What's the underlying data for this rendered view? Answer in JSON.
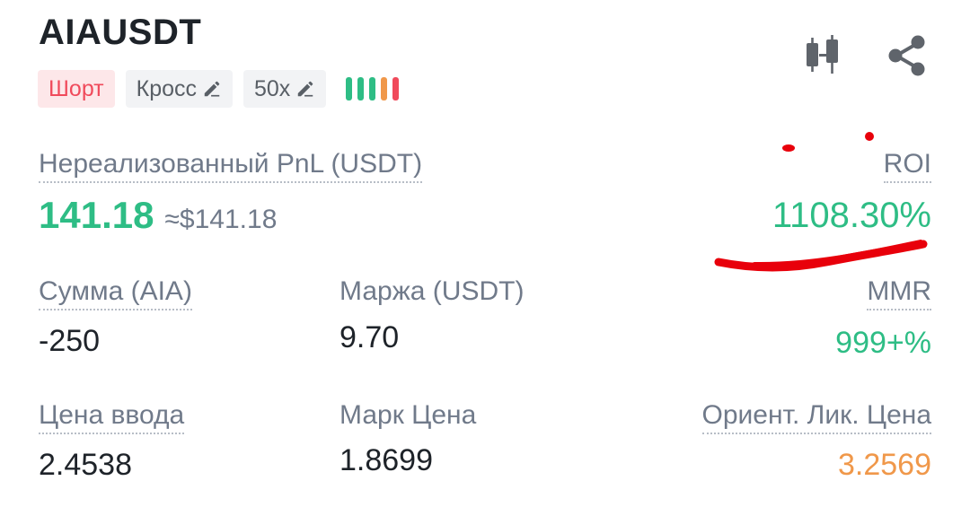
{
  "position": {
    "symbol": "AIAUSDT",
    "side_tag": "Шорт",
    "margin_mode_tag": "Кросс",
    "leverage_tag": "50x",
    "risk_bars": [
      "#2ebd85",
      "#2ebd85",
      "#2ebd85",
      "#f0984a",
      "#f04a5b"
    ]
  },
  "icons": {
    "chart": "candlestick-chart-icon",
    "share": "share-icon",
    "edit": "pencil-icon"
  },
  "pnl": {
    "label": "Нереализованный PnL (USDT)",
    "value": "141.18",
    "usd_equiv": "≈$141.18"
  },
  "roi": {
    "label": "ROI",
    "value": "1108.30%"
  },
  "amount": {
    "label": "Сумма (AIA)",
    "value": "-250"
  },
  "margin": {
    "label": "Маржа (USDT)",
    "value": "9.70"
  },
  "mmr": {
    "label": "MMR",
    "value": "999+%"
  },
  "entry_price": {
    "label": "Цена ввода",
    "value": "2.4538"
  },
  "mark_price": {
    "label": "Марк Цена",
    "value": "1.8699"
  },
  "liq_price": {
    "label": "Ориент. Лик. Цена",
    "value": "3.2569"
  },
  "colors": {
    "profit": "#2ebd85",
    "loss": "#f04a5b",
    "warning": "#f0984a",
    "annotation": "#e8000b"
  }
}
